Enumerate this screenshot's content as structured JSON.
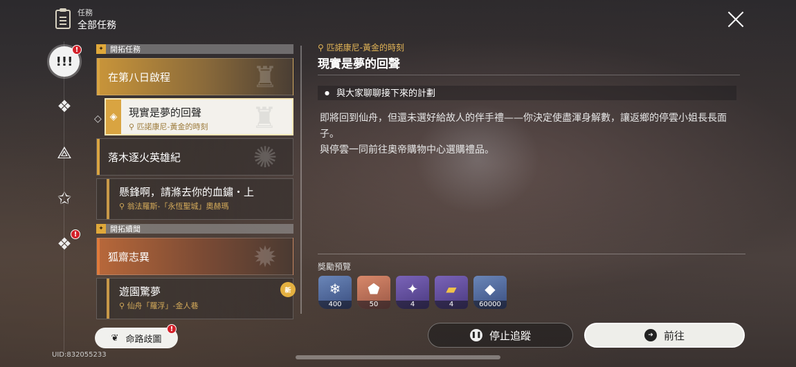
{
  "header": {
    "subtitle": "任務",
    "title": "全部任務"
  },
  "nav": {
    "items": [
      {
        "icon": "exclaim-icon",
        "glyph": "!!!",
        "badge": "!"
      },
      {
        "icon": "diamond-star-icon",
        "glyph": "❖"
      },
      {
        "icon": "triangle-star-icon",
        "glyph": "⟁"
      },
      {
        "icon": "star-icon",
        "glyph": "✩"
      },
      {
        "icon": "diamond-star-icon",
        "glyph": "❖",
        "badge": "!"
      }
    ]
  },
  "sections": [
    {
      "label": "開拓任務"
    },
    {
      "label": "開拓續聞"
    }
  ],
  "quests": [
    {
      "title": "在第八日啟程"
    },
    {
      "title": "現實是夢的回聲",
      "location": "匹諾康尼-黃金的時刻"
    },
    {
      "title": "落木逐火英雄紀"
    },
    {
      "title": "懸鋒啊，請滌去你的血鏽・上",
      "location": "翁法羅斯-「永恆聖城」奧赫瑪"
    },
    {
      "title": "狐齋志異"
    },
    {
      "title": "遊園驚夢",
      "location": "仙舟「羅浮」-金人巷",
      "badge": "新"
    }
  ],
  "detail": {
    "location": "匹諾康尼-黃金的時刻",
    "title": "現實是夢的回聲",
    "objective": "與大家聊聊接下來的計劃",
    "description": [
      "即將回到仙舟，但還未選好給故人的伴手禮——你決定使盡渾身解數，讓返鄉的停雲小姐長長面子。",
      "與停雲一同前往奧帝購物中心選購禮品。"
    ]
  },
  "rewards": {
    "label": "獎勵預覽",
    "items": [
      {
        "icon": "crystal-icon",
        "qty": "400"
      },
      {
        "icon": "shard-icon",
        "qty": "50"
      },
      {
        "icon": "material-icon",
        "qty": "4"
      },
      {
        "icon": "gold-book-icon",
        "qty": "4"
      },
      {
        "icon": "credit-icon",
        "qty": "60000"
      }
    ]
  },
  "buttons": {
    "stop": "停止追蹤",
    "go": "前往",
    "map": "命路歧圖"
  },
  "uid": "UID:832055233",
  "colors": {
    "accent": "#d9a441",
    "alert": "#d3212a"
  }
}
